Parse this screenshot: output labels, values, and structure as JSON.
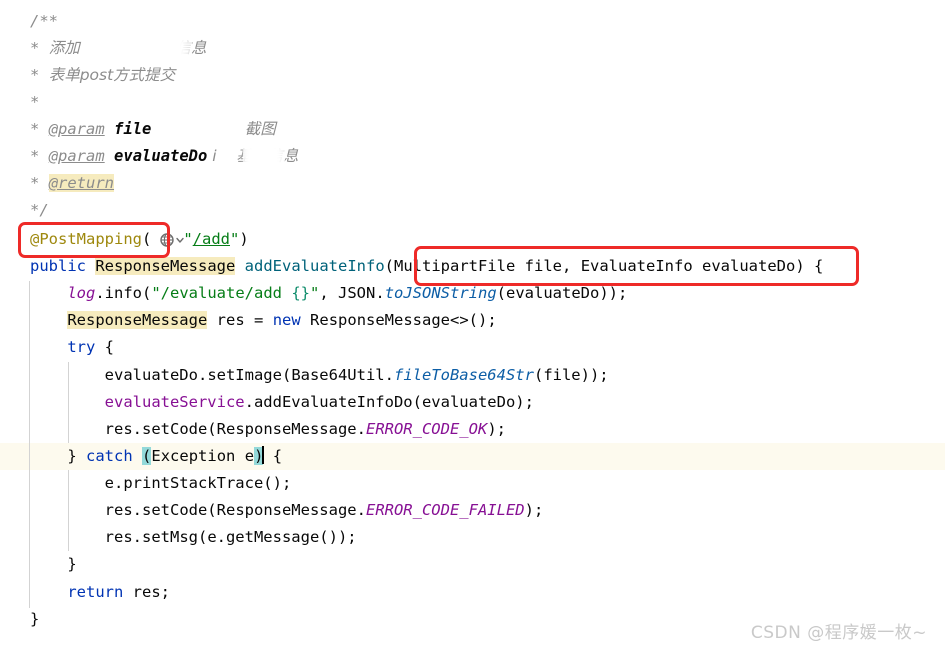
{
  "editor": {
    "language": "java",
    "font_size_px": 15.5,
    "line_height_px": 27,
    "background": "#ffffff",
    "current_line_background": "#fdfaee",
    "identifier_highlight_color": "#f6ebbe",
    "bracket_match_color": "#93d9d9",
    "indent_guide_color": "#d3d3d3",
    "caret_line_index": 13
  },
  "code_lines": [
    {
      "n": 0,
      "text": "/**"
    },
    {
      "n": 1,
      "text": " * 添加          个基础信息"
    },
    {
      "n": 2,
      "text": " * 表单post方式提交"
    },
    {
      "n": 3,
      "text": " *"
    },
    {
      "n": 4,
      "text": " * @param file          截图"
    },
    {
      "n": 5,
      "text": " * @param evaluateDo  i    基础信息"
    },
    {
      "n": 6,
      "text": " * @return"
    },
    {
      "n": 7,
      "text": " */"
    },
    {
      "n": 8,
      "text": "@PostMapping(\"/add\")"
    },
    {
      "n": 9,
      "text": "public ResponseMessage addEvaluateInfo(MultipartFile file, EvaluateInfo evaluateDo) {"
    },
    {
      "n": 10,
      "text": "    log.info(\"/evaluate/add {}\", JSON.toJSONString(evaluateDo));"
    },
    {
      "n": 11,
      "text": "    ResponseMessage res = new ResponseMessage<>();"
    },
    {
      "n": 12,
      "text": "    try {"
    },
    {
      "n": 13,
      "text": "        evaluateDo.setImage(Base64Util.fileToBase64Str(file));"
    },
    {
      "n": 14,
      "text": "        evaluateService.addEvaluateInfoDo(evaluateDo);"
    },
    {
      "n": 15,
      "text": "        res.setCode(ResponseMessage.ERROR_CODE_OK);"
    },
    {
      "n": 16,
      "text": "    } catch (Exception e) {"
    },
    {
      "n": 17,
      "text": "        e.printStackTrace();"
    },
    {
      "n": 18,
      "text": "        res.setCode(ResponseMessage.ERROR_CODE_FAILED);"
    },
    {
      "n": 19,
      "text": "        res.setMsg(e.getMessage());"
    },
    {
      "n": 20,
      "text": "    }"
    },
    {
      "n": 21,
      "text": "    return res;"
    },
    {
      "n": 22,
      "text": "}"
    }
  ],
  "javadoc": {
    "open": "/**",
    "star": "*",
    "close": "*/",
    "line_add_prefix": "添加",
    "line_add_suffix": "个基础信息",
    "line_form": "表单post方式提交",
    "param_tag": "@param",
    "param1_name": "file",
    "param1_desc": "截图",
    "param2_name": "evaluateDo",
    "param2_desc_prefix": "i",
    "param2_desc": "基础信息",
    "return_tag": "@return"
  },
  "code": {
    "annotation": "@PostMapping",
    "annotation_open_paren": "(",
    "mapping_path": "/add",
    "quote": "\"",
    "annotation_close_paren": ")",
    "kw_public": "public",
    "type_response_message": "ResponseMessage",
    "method_name": "addEvaluateInfo",
    "paren_open": "(",
    "param_type_file": "MultipartFile",
    "param_name_file": "file",
    "comma": ",",
    "param_type_info": "EvaluateInfo",
    "param_name_info": "evaluateDo",
    "paren_close": ")",
    "brace_open": "{",
    "brace_close": "}",
    "logger": "log",
    "log_method": ".info(",
    "log_format": "/evaluate/add ",
    "log_placeholder": "{}",
    "json_class": "JSON",
    "json_method": "toJSONString",
    "arg_evaluate_do": "evaluateDo",
    "res_var": "res",
    "assign": "=",
    "kw_new": "new",
    "diamond": "<>();",
    "kw_try": "try",
    "set_image_call": ".setImage(",
    "base64_util": "Base64Util",
    "file_to_base64": "fileToBase64Str",
    "arg_file": "file",
    "evaluate_service": "evaluateService",
    "add_evaluate_info_do": ".addEvaluateInfoDo(",
    "set_code": ".setCode(",
    "error_code_ok": "ERROR_CODE_OK",
    "error_code_failed": "ERROR_CODE_FAILED",
    "kw_catch": "catch",
    "exception_type": "Exception",
    "exception_var": "e",
    "print_stack_trace": "e.printStackTrace();",
    "set_msg": ".setMsg(",
    "get_message": "e.getMessage()",
    "kw_return": "return",
    "semicolon": ";"
  },
  "inlay": {
    "icon": "globe-icon",
    "chevron": "chevron-down-icon",
    "title": "/add"
  },
  "annotations": {
    "box_color": "#ee2a28",
    "boxes": [
      {
        "name": "postmapping-highlight-box",
        "label": "@PostMapping"
      },
      {
        "name": "method-parameters-highlight-box",
        "label": "(MultipartFile file, EvaluateInfo evaluateDo)"
      }
    ]
  },
  "watermark": {
    "text": "CSDN @程序媛一枚~"
  }
}
